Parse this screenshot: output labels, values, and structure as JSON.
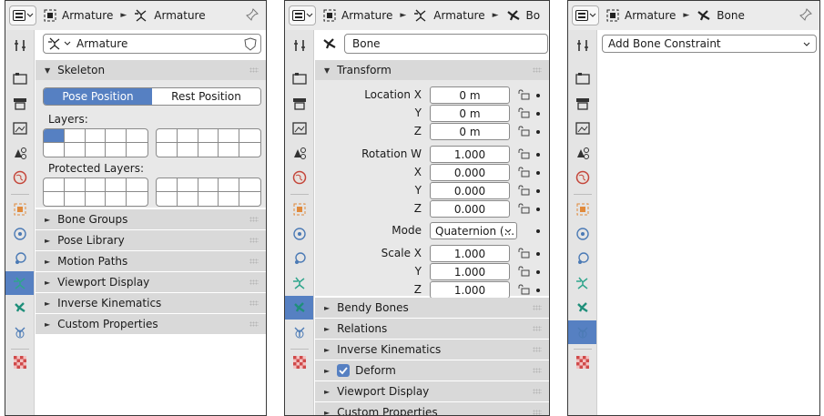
{
  "panel1": {
    "breadcrumb": {
      "object": "Armature",
      "data": "Armature"
    },
    "datablock_name": "Armature",
    "skeleton": {
      "title": "Skeleton",
      "pose_position": "Pose Position",
      "rest_position": "Rest Position",
      "layers_label": "Layers:",
      "protected_label": "Protected Layers:"
    },
    "sections": [
      "Bone Groups",
      "Pose Library",
      "Motion Paths",
      "Viewport Display",
      "Inverse Kinematics",
      "Custom Properties"
    ]
  },
  "panel2": {
    "breadcrumb": {
      "object": "Armature",
      "data": "Armature",
      "bone": "Bo"
    },
    "bone_name": "Bone",
    "transform": {
      "title": "Transform",
      "rows": [
        {
          "label": "Location X",
          "value": "0 m"
        },
        {
          "label": "Y",
          "value": "0 m"
        },
        {
          "label": "Z",
          "value": "0 m"
        },
        {
          "label": "Rotation W",
          "value": "1.000"
        },
        {
          "label": "X",
          "value": "0.000"
        },
        {
          "label": "Y",
          "value": "0.000"
        },
        {
          "label": "Z",
          "value": "0.000"
        },
        {
          "label": "Mode",
          "value": "Quaternion (..."
        },
        {
          "label": "Scale X",
          "value": "1.000"
        },
        {
          "label": "Y",
          "value": "1.000"
        },
        {
          "label": "Z",
          "value": "1.000"
        }
      ]
    },
    "sections": [
      "Bendy Bones",
      "Relations",
      "Inverse Kinematics",
      "Deform",
      "Viewport Display",
      "Custom Properties"
    ]
  },
  "panel3": {
    "breadcrumb": {
      "object": "Armature",
      "bone": "Bone"
    },
    "add_constraint": "Add Bone Constraint"
  },
  "colors": {
    "accent": "#5680c2",
    "header_bg": "#ebebeb",
    "section_bg": "#d9d9d9",
    "body_bg": "#e8e8e8"
  }
}
